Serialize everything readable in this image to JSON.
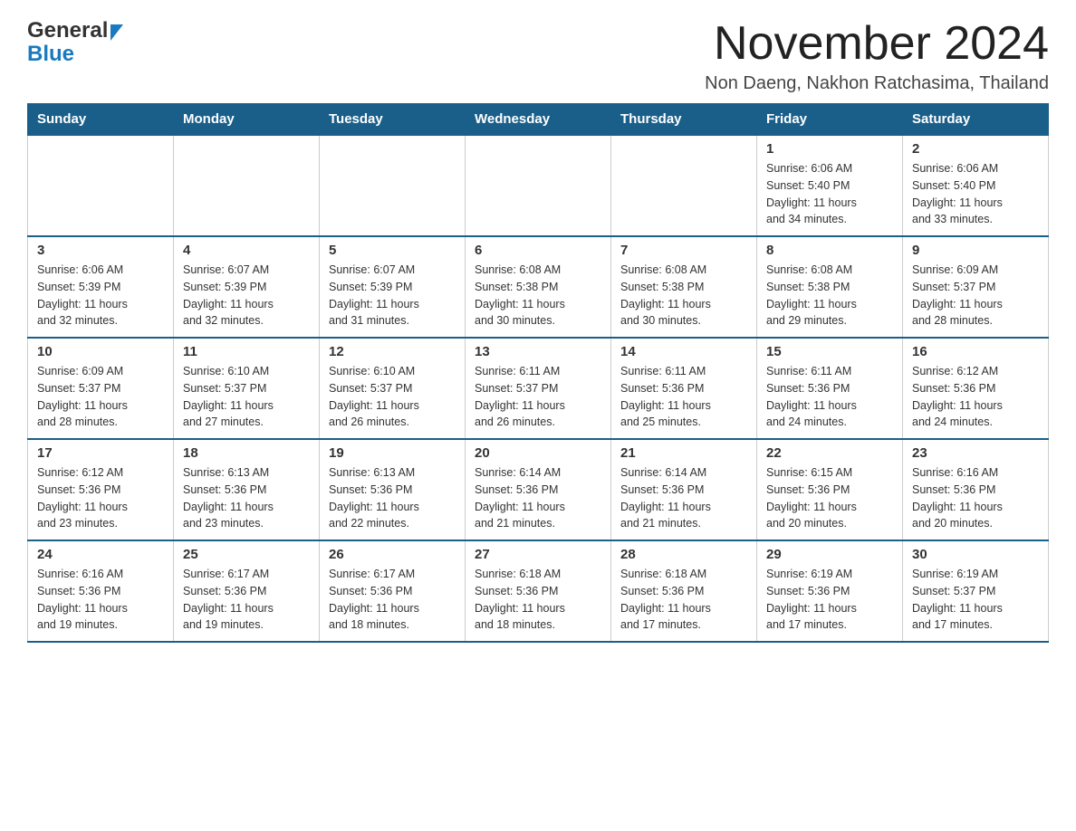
{
  "header": {
    "logo_general": "General",
    "logo_blue": "Blue",
    "month_title": "November 2024",
    "subtitle": "Non Daeng, Nakhon Ratchasima, Thailand"
  },
  "weekdays": [
    "Sunday",
    "Monday",
    "Tuesday",
    "Wednesday",
    "Thursday",
    "Friday",
    "Saturday"
  ],
  "weeks": [
    [
      {
        "day": "",
        "info": ""
      },
      {
        "day": "",
        "info": ""
      },
      {
        "day": "",
        "info": ""
      },
      {
        "day": "",
        "info": ""
      },
      {
        "day": "",
        "info": ""
      },
      {
        "day": "1",
        "info": "Sunrise: 6:06 AM\nSunset: 5:40 PM\nDaylight: 11 hours\nand 34 minutes."
      },
      {
        "day": "2",
        "info": "Sunrise: 6:06 AM\nSunset: 5:40 PM\nDaylight: 11 hours\nand 33 minutes."
      }
    ],
    [
      {
        "day": "3",
        "info": "Sunrise: 6:06 AM\nSunset: 5:39 PM\nDaylight: 11 hours\nand 32 minutes."
      },
      {
        "day": "4",
        "info": "Sunrise: 6:07 AM\nSunset: 5:39 PM\nDaylight: 11 hours\nand 32 minutes."
      },
      {
        "day": "5",
        "info": "Sunrise: 6:07 AM\nSunset: 5:39 PM\nDaylight: 11 hours\nand 31 minutes."
      },
      {
        "day": "6",
        "info": "Sunrise: 6:08 AM\nSunset: 5:38 PM\nDaylight: 11 hours\nand 30 minutes."
      },
      {
        "day": "7",
        "info": "Sunrise: 6:08 AM\nSunset: 5:38 PM\nDaylight: 11 hours\nand 30 minutes."
      },
      {
        "day": "8",
        "info": "Sunrise: 6:08 AM\nSunset: 5:38 PM\nDaylight: 11 hours\nand 29 minutes."
      },
      {
        "day": "9",
        "info": "Sunrise: 6:09 AM\nSunset: 5:37 PM\nDaylight: 11 hours\nand 28 minutes."
      }
    ],
    [
      {
        "day": "10",
        "info": "Sunrise: 6:09 AM\nSunset: 5:37 PM\nDaylight: 11 hours\nand 28 minutes."
      },
      {
        "day": "11",
        "info": "Sunrise: 6:10 AM\nSunset: 5:37 PM\nDaylight: 11 hours\nand 27 minutes."
      },
      {
        "day": "12",
        "info": "Sunrise: 6:10 AM\nSunset: 5:37 PM\nDaylight: 11 hours\nand 26 minutes."
      },
      {
        "day": "13",
        "info": "Sunrise: 6:11 AM\nSunset: 5:37 PM\nDaylight: 11 hours\nand 26 minutes."
      },
      {
        "day": "14",
        "info": "Sunrise: 6:11 AM\nSunset: 5:36 PM\nDaylight: 11 hours\nand 25 minutes."
      },
      {
        "day": "15",
        "info": "Sunrise: 6:11 AM\nSunset: 5:36 PM\nDaylight: 11 hours\nand 24 minutes."
      },
      {
        "day": "16",
        "info": "Sunrise: 6:12 AM\nSunset: 5:36 PM\nDaylight: 11 hours\nand 24 minutes."
      }
    ],
    [
      {
        "day": "17",
        "info": "Sunrise: 6:12 AM\nSunset: 5:36 PM\nDaylight: 11 hours\nand 23 minutes."
      },
      {
        "day": "18",
        "info": "Sunrise: 6:13 AM\nSunset: 5:36 PM\nDaylight: 11 hours\nand 23 minutes."
      },
      {
        "day": "19",
        "info": "Sunrise: 6:13 AM\nSunset: 5:36 PM\nDaylight: 11 hours\nand 22 minutes."
      },
      {
        "day": "20",
        "info": "Sunrise: 6:14 AM\nSunset: 5:36 PM\nDaylight: 11 hours\nand 21 minutes."
      },
      {
        "day": "21",
        "info": "Sunrise: 6:14 AM\nSunset: 5:36 PM\nDaylight: 11 hours\nand 21 minutes."
      },
      {
        "day": "22",
        "info": "Sunrise: 6:15 AM\nSunset: 5:36 PM\nDaylight: 11 hours\nand 20 minutes."
      },
      {
        "day": "23",
        "info": "Sunrise: 6:16 AM\nSunset: 5:36 PM\nDaylight: 11 hours\nand 20 minutes."
      }
    ],
    [
      {
        "day": "24",
        "info": "Sunrise: 6:16 AM\nSunset: 5:36 PM\nDaylight: 11 hours\nand 19 minutes."
      },
      {
        "day": "25",
        "info": "Sunrise: 6:17 AM\nSunset: 5:36 PM\nDaylight: 11 hours\nand 19 minutes."
      },
      {
        "day": "26",
        "info": "Sunrise: 6:17 AM\nSunset: 5:36 PM\nDaylight: 11 hours\nand 18 minutes."
      },
      {
        "day": "27",
        "info": "Sunrise: 6:18 AM\nSunset: 5:36 PM\nDaylight: 11 hours\nand 18 minutes."
      },
      {
        "day": "28",
        "info": "Sunrise: 6:18 AM\nSunset: 5:36 PM\nDaylight: 11 hours\nand 17 minutes."
      },
      {
        "day": "29",
        "info": "Sunrise: 6:19 AM\nSunset: 5:36 PM\nDaylight: 11 hours\nand 17 minutes."
      },
      {
        "day": "30",
        "info": "Sunrise: 6:19 AM\nSunset: 5:37 PM\nDaylight: 11 hours\nand 17 minutes."
      }
    ]
  ]
}
